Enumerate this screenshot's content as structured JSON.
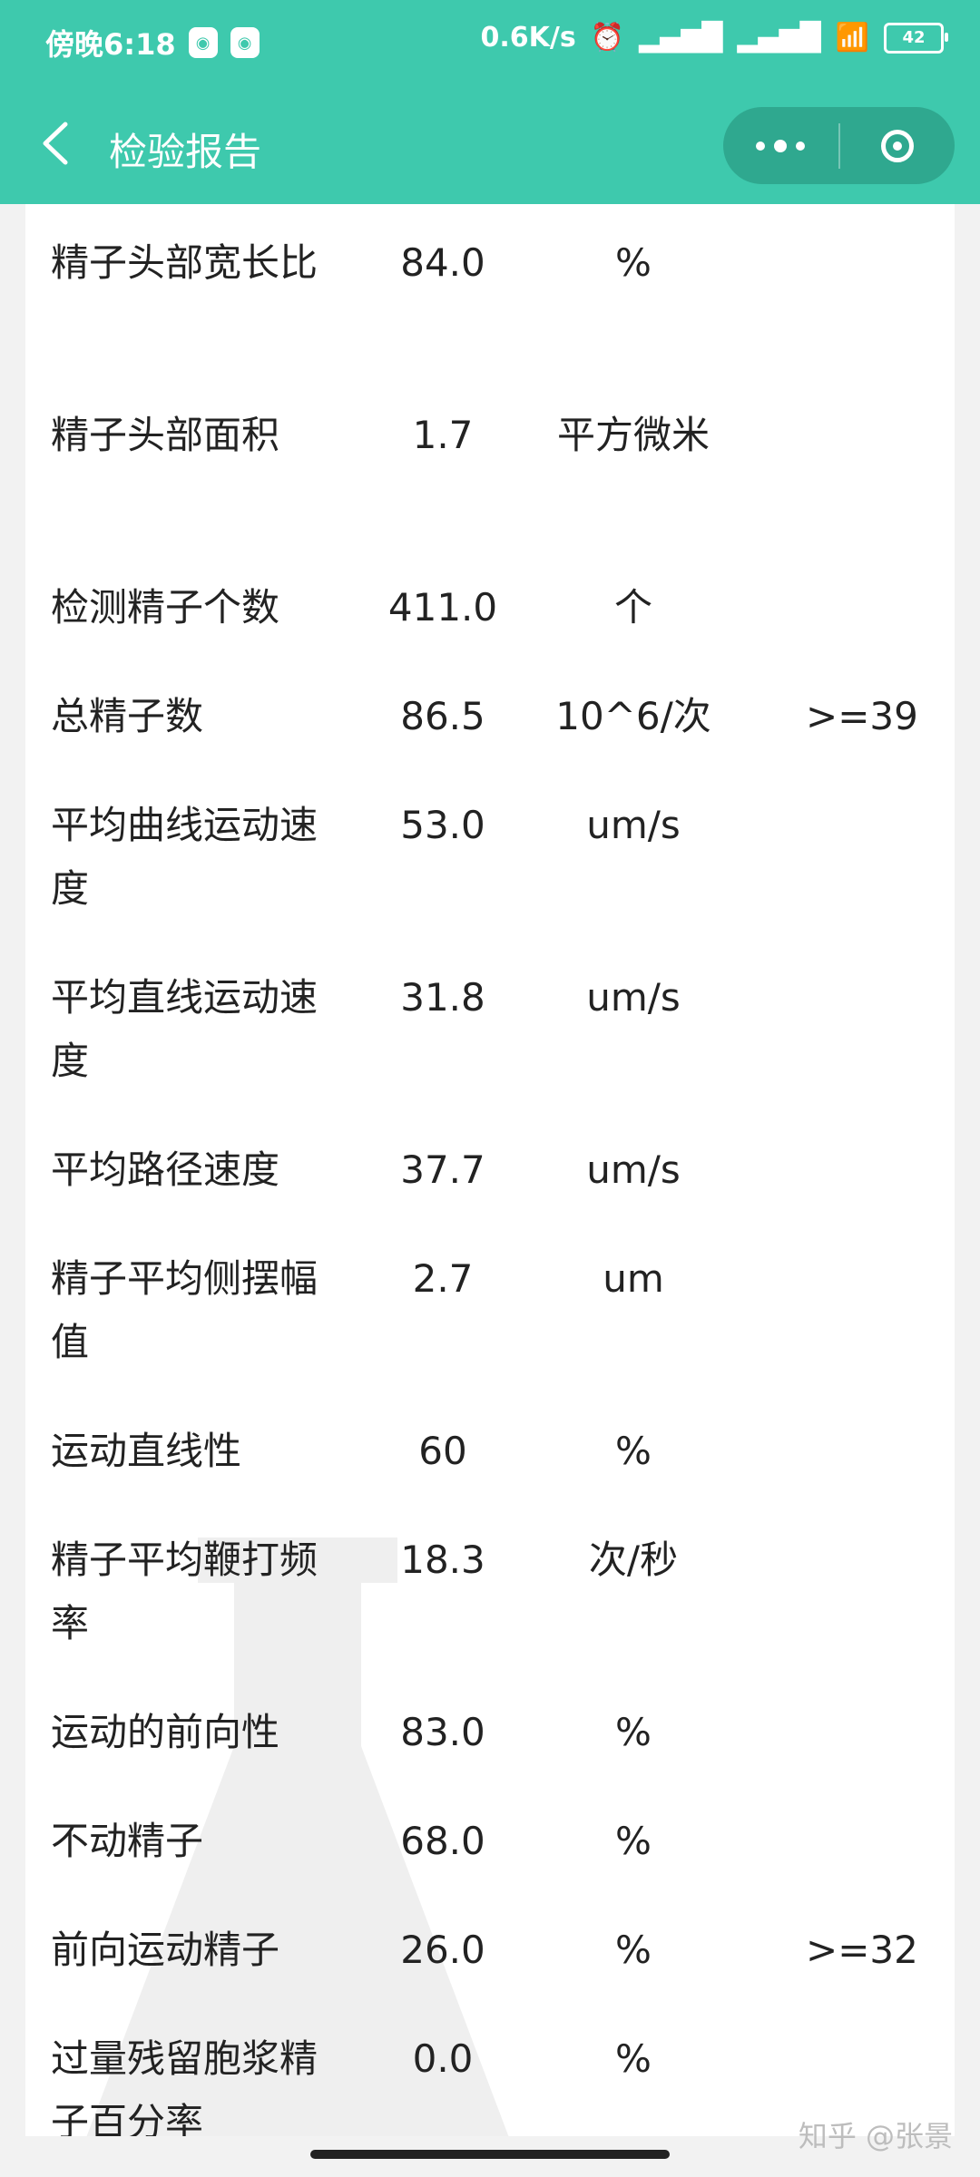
{
  "status": {
    "time": "傍晚6:18",
    "network_speed": "0.6K/s",
    "battery": "42"
  },
  "header": {
    "title": "检验报告"
  },
  "table": {
    "rows": [
      {
        "name": "精子头部宽长比",
        "value": "84.0",
        "unit": "%",
        "ref": ""
      },
      {
        "name": "精子头部面积",
        "value": "1.7",
        "unit": "平方微米",
        "ref": ""
      },
      {
        "name": "检测精子个数",
        "value": "411.0",
        "unit": "个",
        "ref": ""
      },
      {
        "name": "总精子数",
        "value": "86.5",
        "unit": "10^6/次",
        "ref": ">=39"
      },
      {
        "name": "平均曲线运动速度",
        "value": "53.0",
        "unit": "um/s",
        "ref": ""
      },
      {
        "name": "平均直线运动速度",
        "value": "31.8",
        "unit": "um/s",
        "ref": ""
      },
      {
        "name": "平均路径速度",
        "value": "37.7",
        "unit": "um/s",
        "ref": ""
      },
      {
        "name": "精子平均侧摆幅值",
        "value": "2.7",
        "unit": "um",
        "ref": ""
      },
      {
        "name": "运动直线性",
        "value": "60",
        "unit": "%",
        "ref": ""
      },
      {
        "name": "精子平均鞭打频率",
        "value": "18.3",
        "unit": "次/秒",
        "ref": ""
      },
      {
        "name": "运动的前向性",
        "value": "83.0",
        "unit": "%",
        "ref": ""
      },
      {
        "name": "不动精子",
        "value": "68.0",
        "unit": "%",
        "ref": ""
      },
      {
        "name": "前向运动精子",
        "value": "26.0",
        "unit": "%",
        "ref": ">=32"
      },
      {
        "name": "过量残留胞浆精子百分率",
        "value": "0.0",
        "unit": "%",
        "ref": ""
      }
    ]
  },
  "footer": {
    "watermark_text": "知乎 @张景"
  }
}
